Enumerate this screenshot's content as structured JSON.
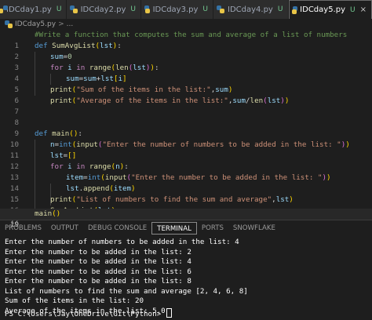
{
  "tabs": [
    {
      "label": "IDCday1.py",
      "status": "U",
      "active": false
    },
    {
      "label": "IDCday2.py",
      "status": "U",
      "active": false
    },
    {
      "label": "IDCday3.py",
      "status": "U",
      "active": false
    },
    {
      "label": "IDCday4.py",
      "status": "U",
      "active": false
    },
    {
      "label": "IDCday5.py",
      "status": "U",
      "active": true
    }
  ],
  "close_glyph": "×",
  "breadcrumb": {
    "file": "IDCday5.py",
    "separator": ">",
    "trail": "..."
  },
  "editor": {
    "line_numbers": [
      "1",
      "2",
      "3",
      "4",
      "5",
      "6",
      "7",
      "8",
      "9",
      "10",
      "11",
      "12",
      "13",
      "14",
      "15",
      "16",
      "17",
      "18",
      "19"
    ],
    "current_line": "19",
    "text": {
      "comment": "#Write a function that computes the sum and average of a list of numbers",
      "def": "def",
      "sumavg": "SumAvgList",
      "lst": "lst",
      "sum": "sum",
      "zero": "0",
      "for": "for",
      "i": "i",
      "in": "in",
      "range": "range",
      "len": "len",
      "print": "print",
      "str_sum": "\"Sum of the items in the list:\"",
      "str_avg": "\"Average of the items in the list:\"",
      "main": "main",
      "n": "n",
      "int": "int",
      "input": "input",
      "str_enter_n": "\"Enter the number of numbers to be added in the list: \"",
      "item": "item",
      "str_enter_one": "\"Enter the number to be added in the list: \"",
      "append": "append",
      "str_list": "\"List of numbers to find the sum and average\""
    }
  },
  "panel": {
    "tabs": [
      "PROBLEMS",
      "OUTPUT",
      "DEBUG CONSOLE",
      "TERMINAL",
      "PORTS",
      "SNOWFLAKE"
    ],
    "active_tab": "TERMINAL"
  },
  "terminal": {
    "lines": [
      "Enter the number of numbers to be added in the list: 4",
      "Enter the number to be added in the list: 2",
      "Enter the number to be added in the list: 4",
      "Enter the number to be added in the list: 6",
      "Enter the number to be added in the list: 8",
      "List of numbers to find the sum and average [2, 4, 6, 8]",
      "Sum of the items in the list: 20",
      "Average of the items in the list: 5.0"
    ],
    "prompt": "PS C:\\Users\\Jay\\OneDrive\\Git\\Python> "
  }
}
